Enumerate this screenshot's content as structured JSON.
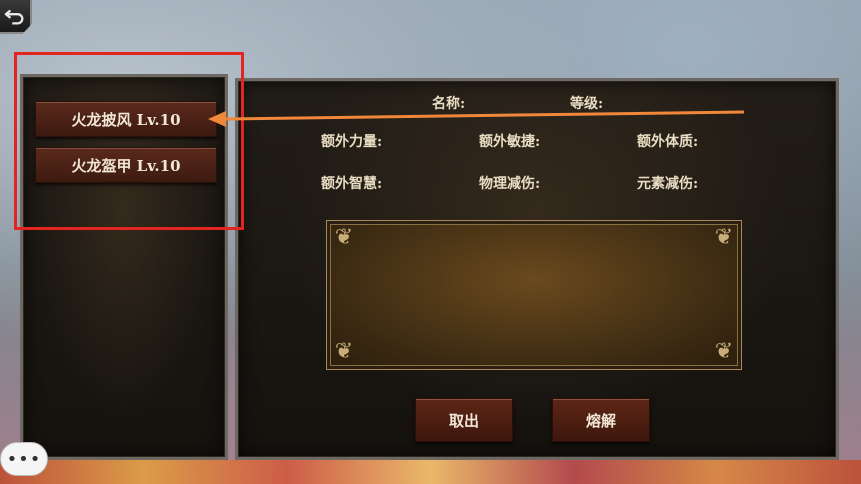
{
  "left_panel": {
    "items": [
      {
        "label": "火龙披风 Lv.10"
      },
      {
        "label": "火龙盔甲 Lv.10"
      }
    ]
  },
  "detail_panel": {
    "name_label": "名称:",
    "level_label": "等级:",
    "stats": [
      "额外力量:",
      "额外敏捷:",
      "额外体质:",
      "额外智慧:",
      "物理减伤:",
      "元素减伤:"
    ]
  },
  "actions": {
    "take_out": "取出",
    "smelt": "熔解"
  },
  "chat": {
    "icon_text": "•••"
  },
  "colors": {
    "highlight_red": "#e32521",
    "arrow_orange": "#f0873a",
    "button_brown": "#4a2014",
    "label_text": "#e8dcc2"
  }
}
